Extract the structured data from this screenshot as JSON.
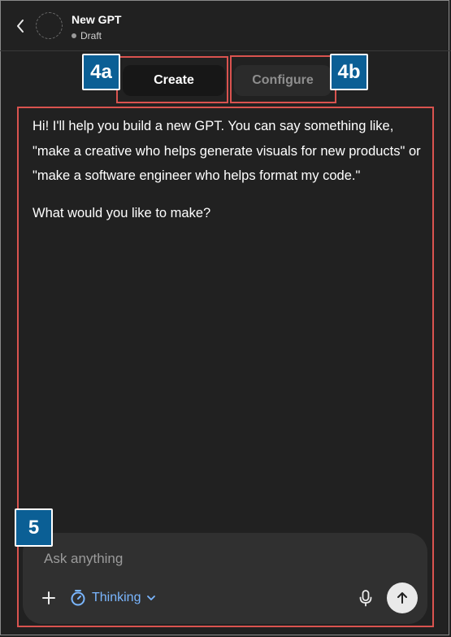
{
  "header": {
    "back_icon": "chevron-left-icon",
    "title": "New GPT",
    "status": "Draft"
  },
  "tabs": {
    "create": "Create",
    "configure": "Configure"
  },
  "annotations": {
    "create_tab_badge": "4a",
    "configure_tab_badge": "4b",
    "chat_badge": "5",
    "badge_color": "#0b5f95",
    "outline_color": "#d9534f"
  },
  "message": {
    "intro": "Hi! I'll help you build a new GPT. You can say something like, \"make a creative who helps generate visuals for new products\" or \"make a software engineer who helps format my code.\"",
    "question": "What would you like to make?"
  },
  "composer": {
    "placeholder": "Ask anything",
    "add_icon": "plus-icon",
    "mode_label": "Thinking",
    "mode_icon": "timer-icon",
    "mic_icon": "microphone-icon",
    "send_icon": "arrow-up-icon"
  },
  "colors": {
    "background": "#212121",
    "accent": "#7ab6ff"
  }
}
